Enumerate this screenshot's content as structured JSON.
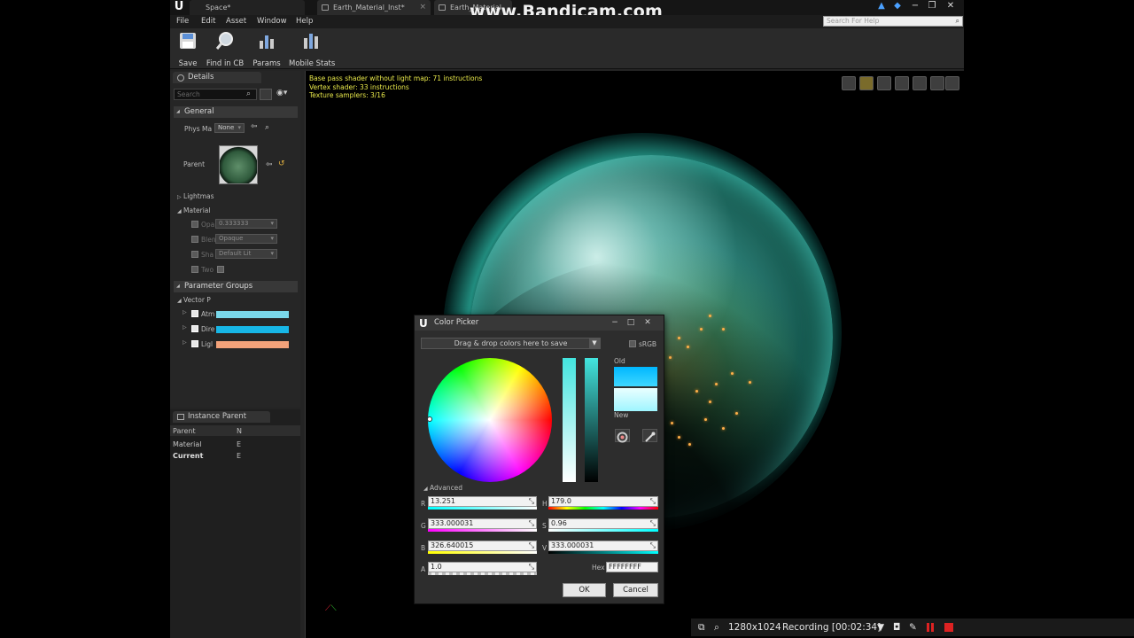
{
  "title_tabs": [
    "Space*",
    "Earth_Material_Inst*",
    "Earth_Material"
  ],
  "watermark": "www.Bandicam.com",
  "menu": [
    "File",
    "Edit",
    "Asset",
    "Window",
    "Help"
  ],
  "help_search": {
    "placeholder": "Search For Help"
  },
  "toolbar": [
    {
      "label": "Save",
      "icon": "save-icon"
    },
    {
      "label": "Find in CB",
      "icon": "find-in-cb-icon"
    },
    {
      "label": "Params",
      "icon": "params-icon"
    },
    {
      "label": "Mobile Stats",
      "icon": "mobile-stats-icon"
    }
  ],
  "details": {
    "tab": "Details",
    "search_placeholder": "Search",
    "general": "General",
    "phys_label": "Phys Ma",
    "phys_value": "None",
    "parent_label": "Parent",
    "lightmass": "Lightmas",
    "material": "Material",
    "mat_rows": [
      {
        "label": "Opa",
        "value": "0.333333"
      },
      {
        "label": "Blen",
        "value": "Opaque"
      },
      {
        "label": "Sha",
        "value": "Default Lit"
      },
      {
        "label": "Two",
        "value": ""
      }
    ],
    "param_groups": "Parameter Groups",
    "vector_params": "Vector P",
    "vector_rows": [
      {
        "label": "Atm",
        "color": "#7ad8ea"
      },
      {
        "label": "Dire",
        "color": "#17b6e6"
      },
      {
        "label": "Ligl",
        "color": "#f3a27a"
      }
    ]
  },
  "instance_parents": {
    "tab": "Instance Parent",
    "rows": [
      {
        "a": "Parent",
        "b": "N"
      },
      {
        "a": "Material",
        "b": "E"
      },
      {
        "a": "Current",
        "b": "E"
      }
    ]
  },
  "viewport": {
    "stats": [
      "Base pass shader without light map: 71 instructions",
      "Vertex shader: 33 instructions",
      "Texture samplers: 3/16"
    ]
  },
  "status": {
    "resolution": "1280x1024",
    "recording": "Recording [00:02:34]"
  },
  "color_picker": {
    "title": "Color Picker",
    "drop_text": "Drag & drop colors here to save",
    "srgb": "sRGB",
    "old_label": "Old",
    "new_label": "New",
    "advanced": "Advanced",
    "R": "13.251",
    "G": "333.000031",
    "B": "326.640015",
    "A": "1.0",
    "H": "179.0",
    "S": "0.96",
    "V": "333.000031",
    "hex_label": "Hex",
    "hex": "FFFFFFFF",
    "ok": "OK",
    "cancel": "Cancel",
    "labels": {
      "r": "R",
      "g": "G",
      "b": "B",
      "a": "A",
      "h": "H",
      "s": "S",
      "v": "V"
    }
  }
}
